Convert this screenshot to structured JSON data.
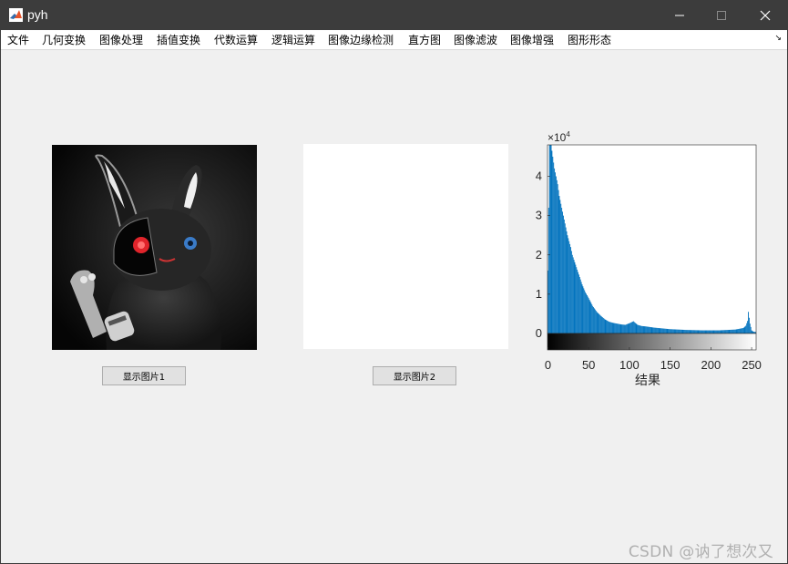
{
  "window": {
    "title": "pyh"
  },
  "menu": {
    "items": [
      "文件",
      "几何变换",
      "图像处理",
      "插值变换",
      "代数运算",
      "逻辑运算",
      "图像边缘检测",
      "直方图",
      "图像滤波",
      "图像增强",
      "图形形态"
    ],
    "overflow_icon": "chevron-icon"
  },
  "buttons": {
    "show_image_1": "显示图片1",
    "show_image_2": "显示图片2"
  },
  "chart_data": {
    "type": "bar",
    "title": "",
    "xlabel": "结果",
    "ylabel": "",
    "y_exponent_label": "×10",
    "y_exponent_power": "4",
    "xlim": [
      0,
      255
    ],
    "ylim": [
      0,
      48000
    ],
    "xticks": [
      0,
      50,
      100,
      150,
      200,
      250
    ],
    "yticks": [
      0,
      1,
      2,
      3,
      4
    ],
    "bar_color": "#0072bd",
    "colorbar": "grayscale-gradient",
    "x": [
      0,
      2,
      4,
      6,
      8,
      10,
      12,
      14,
      16,
      18,
      20,
      22,
      24,
      26,
      28,
      30,
      34,
      38,
      42,
      46,
      50,
      55,
      60,
      65,
      70,
      75,
      80,
      85,
      90,
      95,
      100,
      105,
      110,
      115,
      120,
      130,
      140,
      150,
      160,
      170,
      180,
      190,
      200,
      210,
      220,
      230,
      235,
      240,
      243,
      245,
      246,
      248,
      250,
      252,
      254
    ],
    "values": [
      16000,
      48000,
      48000,
      45000,
      42000,
      40000,
      38000,
      35000,
      33000,
      31000,
      29000,
      27000,
      25000,
      23500,
      22000,
      20000,
      17500,
      15000,
      12500,
      10500,
      9000,
      7000,
      5500,
      4500,
      3600,
      3000,
      2700,
      2500,
      2300,
      2200,
      2600,
      3100,
      2200,
      1900,
      1800,
      1500,
      1300,
      1100,
      1000,
      900,
      850,
      800,
      800,
      800,
      900,
      1000,
      1200,
      1400,
      2000,
      3200,
      5500,
      2500,
      800,
      500,
      400
    ]
  },
  "watermark": "CSDN @讷了想次又"
}
